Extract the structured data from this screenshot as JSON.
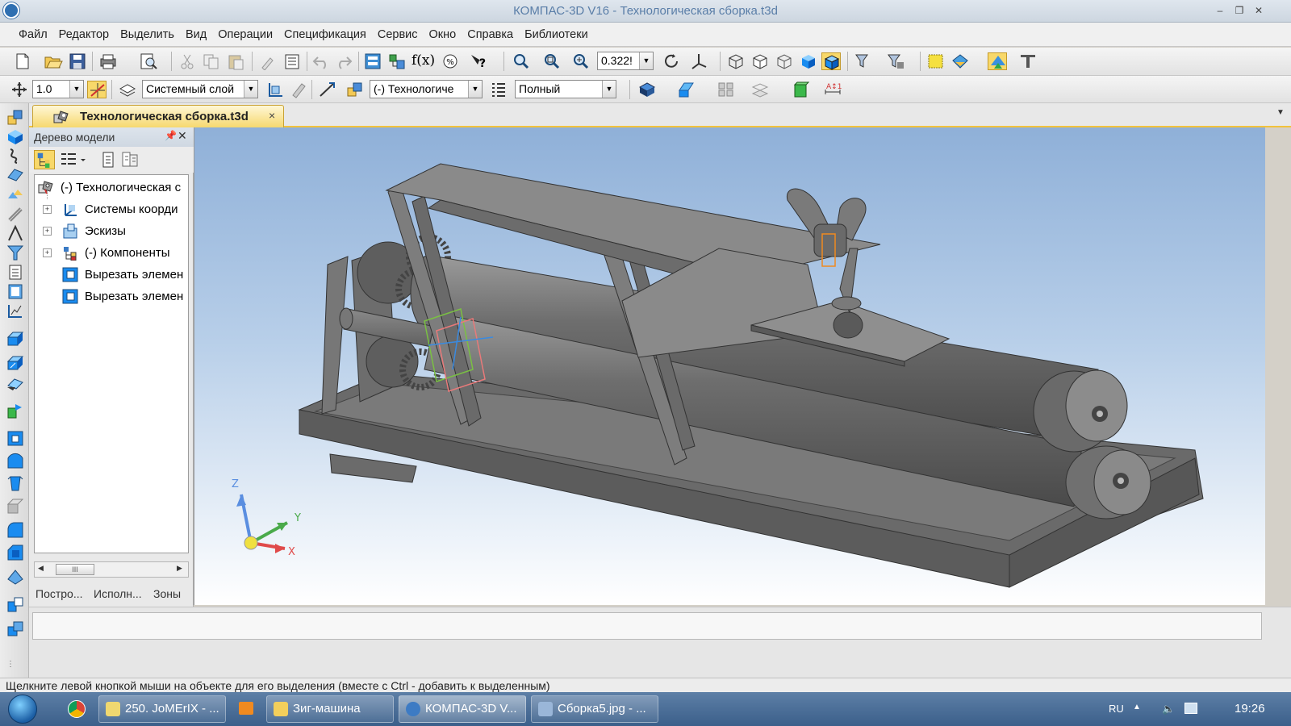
{
  "window": {
    "title": "КОМПАС-3D V16  - Технологическая сборка.t3d",
    "buttons": [
      "–",
      "❐",
      "✕"
    ]
  },
  "menu": [
    "Файл",
    "Редактор",
    "Выделить",
    "Вид",
    "Операции",
    "Спецификация",
    "Сервис",
    "Окно",
    "Справка",
    "Библиотеки"
  ],
  "toolbar1": {
    "zoom_value": "0.322!",
    "icons": [
      "new-document-icon",
      "open-icon",
      "save-icon",
      "print-icon",
      "preview-icon",
      "cut-icon",
      "copy-icon",
      "paste-icon",
      "format-brush-icon",
      "properties-icon",
      "undo-icon",
      "redo-icon",
      "manager-icon",
      "tree-icon",
      "variables-icon",
      "measure-icon",
      "help-icon",
      "zoom-window-icon",
      "zoom-fit-icon",
      "zoom-in-icon",
      "rotate-icon",
      "orientation-icon",
      "wireframe-icon",
      "hidden-lines-icon",
      "halftone-icon",
      "shaded-icon",
      "shaded-edges-icon",
      "filter-icon",
      "select-filter-icon",
      "highlight-icon",
      "library-icon",
      "apps-icon",
      "tools-icon"
    ]
  },
  "toolbar2": {
    "step_value": "1.0",
    "layer_value": "Системный слой",
    "process_value": "(-) Технологиче",
    "mode_value": "Полный"
  },
  "document_tab": {
    "label": "Технологическая сборка.t3d",
    "close": "×"
  },
  "tree_panel": {
    "title": "Дерево модели",
    "pin": "ᵖ",
    "close": "✕",
    "items": [
      {
        "label": "(-) Технологическая с",
        "expander": "",
        "icon": "assembly-icon",
        "level": 0
      },
      {
        "label": "Системы коорди",
        "expander": "+",
        "icon": "coordinate-system-icon",
        "level": 1
      },
      {
        "label": "Эскизы",
        "expander": "+",
        "icon": "sketch-folder-icon",
        "level": 1
      },
      {
        "label": "(-) Компоненты",
        "expander": "+",
        "icon": "components-icon",
        "level": 1
      },
      {
        "label": "Вырезать элемен",
        "expander": "",
        "icon": "cut-extrude-icon",
        "level": 1
      },
      {
        "label": "Вырезать элемен",
        "expander": "",
        "icon": "cut-extrude-icon",
        "level": 1
      }
    ],
    "scroll_grip": "III",
    "tabs": [
      "Постро...",
      "Исполн...",
      "Зоны"
    ]
  },
  "viewport": {
    "triad": {
      "x": "X",
      "y": "Y",
      "z": "Z"
    }
  },
  "status": {
    "text": "Щелкните левой кнопкой мыши на объекте для его выделения (вместе с Ctrl - добавить к выделенным)"
  },
  "taskbar": {
    "items": [
      {
        "label": "250. JoMErIX - ...",
        "icon_color": "#f0d870",
        "active": false
      },
      {
        "label": "Зиг-машина",
        "icon_color": "#f3cf5b",
        "active": false
      },
      {
        "label": "КОМПАС-3D V...",
        "icon_color": "#3d7bc4",
        "active": true
      },
      {
        "label": "Сборка5.jpg - ...",
        "icon_color": "#9ab6d8",
        "active": false
      }
    ],
    "lang": "RU",
    "time": "19:26"
  }
}
